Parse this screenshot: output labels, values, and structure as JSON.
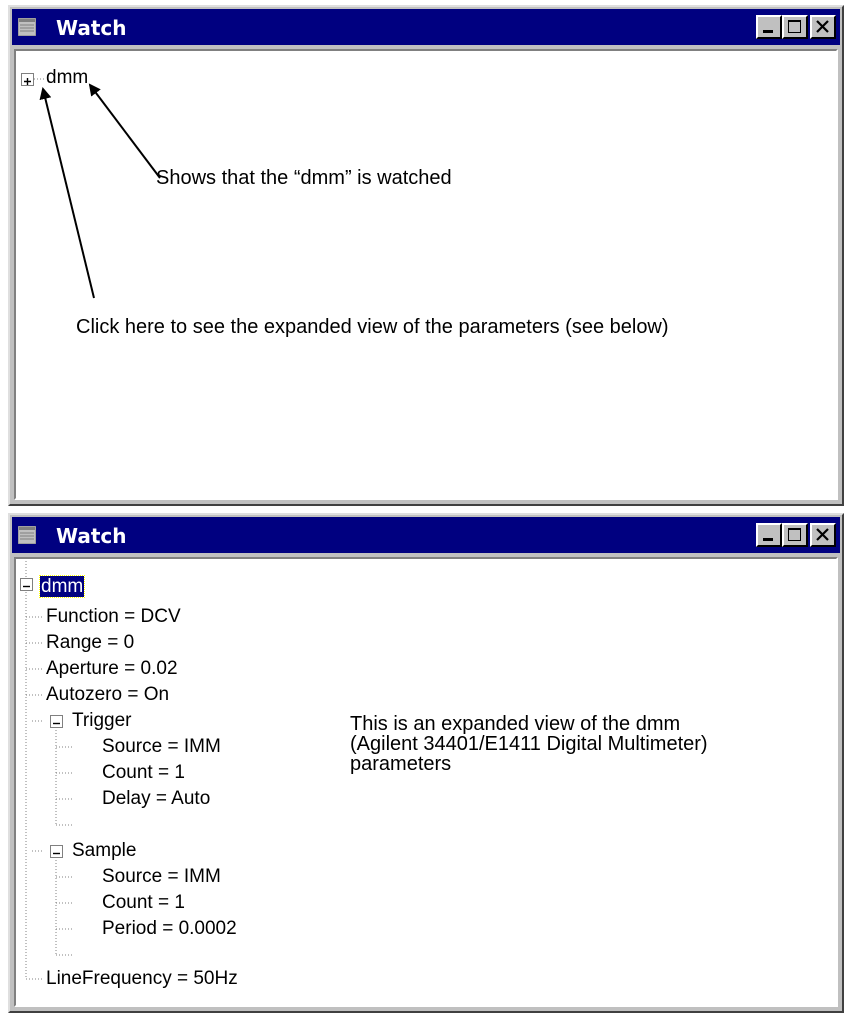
{
  "colors": {
    "titlebar": "#000080",
    "frame": "#c0c0c0",
    "client": "#ffffff",
    "selection": "#000080",
    "tree_lines": "#808080"
  },
  "window_top": {
    "title": "Watch",
    "system_icon": "window-menu-icon",
    "buttons": [
      "minimize-icon",
      "maximize-icon",
      "close-icon"
    ],
    "tree_root": {
      "label": "dmm",
      "state": "collapsed",
      "expander_icon": "plus-box-icon"
    },
    "annotations": {
      "watched": "Shows that the “dmm” is watched",
      "expand": "Click here to see the expanded view of the parameters (see below)"
    }
  },
  "window_bottom": {
    "title": "Watch",
    "system_icon": "window-menu-icon",
    "buttons": [
      "minimize-icon",
      "maximize-icon",
      "close-icon"
    ],
    "tree_root": {
      "label": "dmm",
      "state": "expanded",
      "selected": true,
      "expander_icon": "minus-box-icon"
    },
    "tree": [
      {
        "label": "Function = DCV"
      },
      {
        "label": "Range = 0"
      },
      {
        "label": "Aperture = 0.02"
      },
      {
        "label": "Autozero = On"
      },
      {
        "label": "Trigger",
        "children": [
          "Source = IMM",
          "Count = 1",
          "Delay = Auto"
        ]
      },
      {
        "label": "Sample",
        "children": [
          "Source = IMM",
          "Count = 1",
          "Period = 0.0002"
        ]
      },
      {
        "label": "LineFrequency = 50Hz"
      }
    ],
    "annotation_lines": [
      "This is an expanded view of the dmm",
      "(Agilent 34401/E1411 Digital Multimeter)",
      "parameters"
    ]
  }
}
